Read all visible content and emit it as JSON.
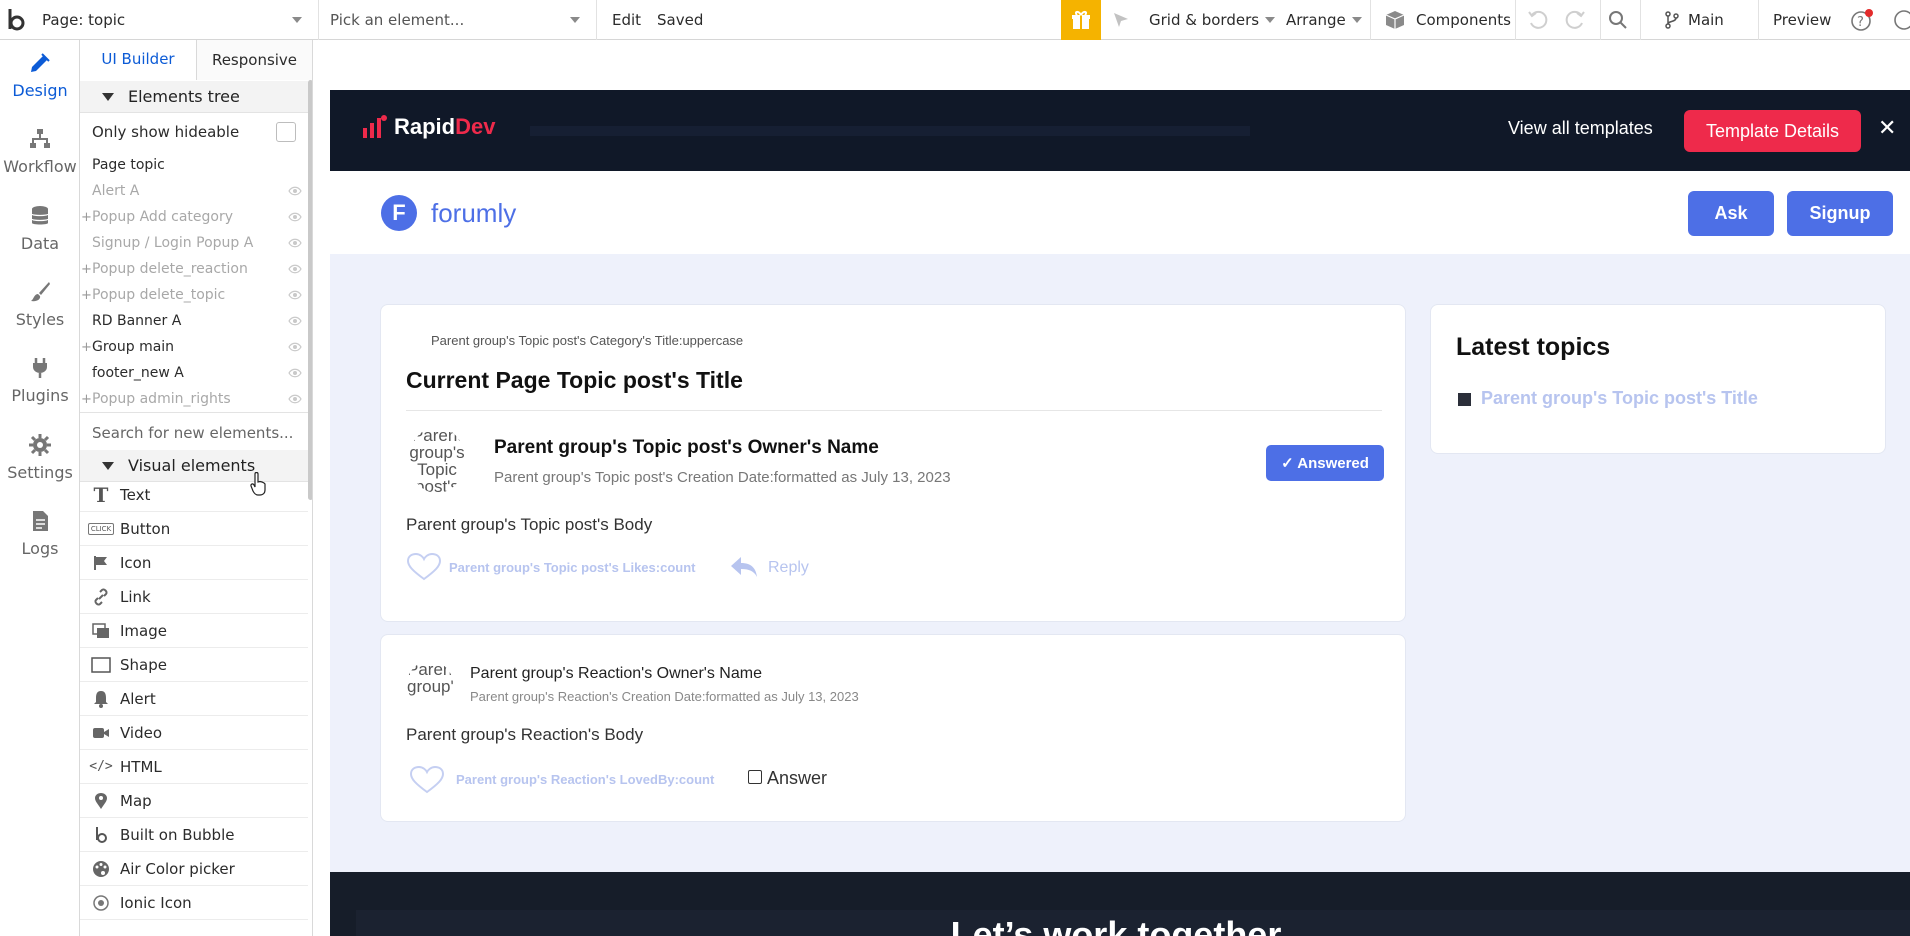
{
  "topbar": {
    "page_label": "Page: topic",
    "element_placeholder": "Pick an element...",
    "edit": "Edit",
    "saved": "Saved",
    "grid_borders": "Grid & borders",
    "arrange": "Arrange",
    "components": "Components",
    "branch": "Main",
    "preview": "Preview"
  },
  "rail": {
    "items": [
      {
        "label": "Design",
        "icon": "design-icon"
      },
      {
        "label": "Workflow",
        "icon": "workflow-icon"
      },
      {
        "label": "Data",
        "icon": "database-icon"
      },
      {
        "label": "Styles",
        "icon": "brush-icon"
      },
      {
        "label": "Plugins",
        "icon": "plug-icon"
      },
      {
        "label": "Settings",
        "icon": "gear-icon"
      },
      {
        "label": "Logs",
        "icon": "document-icon"
      }
    ]
  },
  "panel": {
    "tabs": [
      "UI Builder",
      "Responsive"
    ],
    "elements_tree_title": "Elements tree",
    "only_show_hideable": "Only show hideable",
    "tree": [
      {
        "label": "Page topic",
        "muted": false,
        "plus": false,
        "eye": false
      },
      {
        "label": "Alert A",
        "muted": true,
        "plus": false,
        "eye": true
      },
      {
        "label": "Popup Add category",
        "muted": true,
        "plus": true,
        "eye": true
      },
      {
        "label": "Signup / Login Popup A",
        "muted": true,
        "plus": false,
        "eye": true
      },
      {
        "label": "Popup delete_reaction",
        "muted": true,
        "plus": true,
        "eye": true
      },
      {
        "label": "Popup delete_topic",
        "muted": true,
        "plus": true,
        "eye": true
      },
      {
        "label": "RD Banner A",
        "muted": false,
        "plus": false,
        "eye": true
      },
      {
        "label": "Group main",
        "muted": false,
        "plus": true,
        "eye": true
      },
      {
        "label": "footer_new A",
        "muted": false,
        "plus": false,
        "eye": true
      },
      {
        "label": "Popup admin_rights",
        "muted": true,
        "plus": true,
        "eye": true
      }
    ],
    "search_placeholder": "Search for new elements...",
    "visual_elements_title": "Visual elements",
    "visual_elements": [
      {
        "label": "Text",
        "icon": "text-icon"
      },
      {
        "label": "Button",
        "icon": "button-icon"
      },
      {
        "label": "Icon",
        "icon": "flag-icon"
      },
      {
        "label": "Link",
        "icon": "link-icon"
      },
      {
        "label": "Image",
        "icon": "image-icon"
      },
      {
        "label": "Shape",
        "icon": "shape-icon"
      },
      {
        "label": "Alert",
        "icon": "bell-icon"
      },
      {
        "label": "Video",
        "icon": "video-icon"
      },
      {
        "label": "HTML",
        "icon": "code-icon"
      },
      {
        "label": "Map",
        "icon": "map-pin-icon"
      },
      {
        "label": "Built on Bubble",
        "icon": "bubble-icon"
      },
      {
        "label": "Air Color picker",
        "icon": "palette-icon"
      },
      {
        "label": "Ionic Icon",
        "icon": "ionic-icon"
      }
    ],
    "button_icon_text": "CLICK"
  },
  "banner": {
    "logo_rapid": "Rapid",
    "logo_dev": "Dev",
    "view_templates": "View all templates",
    "template_details": "Template Details",
    "close": "✕"
  },
  "header": {
    "brand_initial": "F",
    "brand": "forumly",
    "ask": "Ask",
    "signup": "Signup"
  },
  "topic": {
    "category": "Parent group's Topic post's Category's Title:uppercase",
    "title": "Current Page Topic post's Title",
    "avatar_text": "Parent group's Topic post's",
    "owner": "Parent group's Topic post's Owner's Name",
    "date": "Parent group's Topic post's Creation Date:formatted as July 13, 2023",
    "answered": "✓ Answered",
    "body": "Parent group's Topic post's Body",
    "likes": "Parent group's Topic post's Likes:count",
    "reply": "Reply"
  },
  "reaction": {
    "avatar_text": "Parent group's",
    "owner": "Parent group's Reaction's Owner's Name",
    "date": "Parent group's Reaction's Creation Date:formatted as July 13, 2023",
    "body": "Parent group's Reaction's Body",
    "loved": "Parent group's Reaction's LovedBy:count",
    "answer": "Answer"
  },
  "latest": {
    "title": "Latest topics",
    "item": "Parent group's Topic post's Title"
  },
  "footer": {
    "title": "Let’s work together."
  },
  "colors": {
    "accent": "#4d6fe6",
    "bubble_blue": "#0c5bd6",
    "banner_bg": "#101828",
    "template_btn": "#ee2a4b",
    "page_bg": "#eef1fb",
    "gift": "#f5b300"
  }
}
